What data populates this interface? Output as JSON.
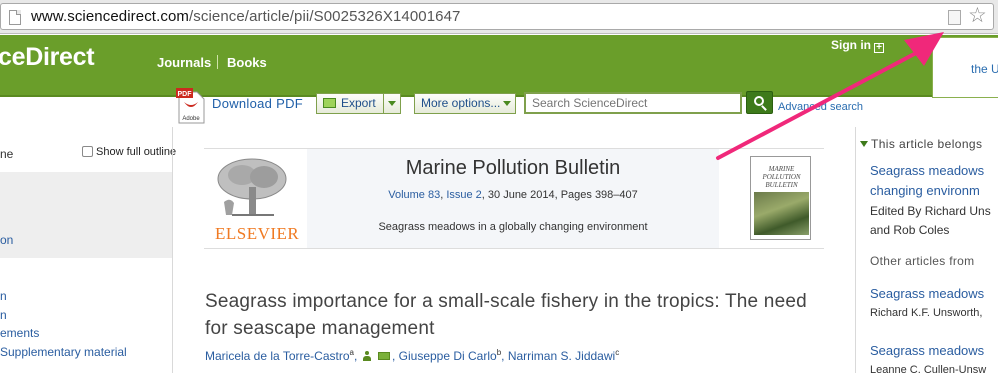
{
  "browser": {
    "url_host": "www.sciencedirect.com",
    "url_path": "/science/article/pii/S0025326X14001647"
  },
  "header": {
    "logo": "ceDirect",
    "nav": [
      "Journals",
      "Books"
    ],
    "sign_in": "Sign in",
    "institution_text": "the U"
  },
  "toolbar": {
    "download_pdf": "Download PDF",
    "pdf_icon_text": "PDF",
    "pdf_icon_sub": "Adobe",
    "export": "Export",
    "more_options": "More options...",
    "search_placeholder": "Search ScienceDirect",
    "advanced_search": "Advanced search"
  },
  "outline": {
    "label": "ne",
    "show_full_outline": "Show full outline",
    "items": [
      "on",
      "n",
      "n",
      "ements",
      "Supplementary material"
    ]
  },
  "journal": {
    "publisher": "ELSEVIER",
    "title": "Marine Pollution Bulletin",
    "volume": "Volume 83",
    "issue": "Issue 2",
    "date_pages": ", 30 June 2014, Pages 398–407",
    "special_issue": "Seagrass meadows in a globally changing environment",
    "cover_title": "MARINE POLLUTION BULLETIN"
  },
  "article": {
    "title": "Seagrass importance for a small-scale fishery in the tropics: The need for seascape management",
    "authors": [
      {
        "name": "Maricela de la Torre-Castro",
        "sup": "a"
      },
      {
        "name": "Giuseppe Di Carlo",
        "sup": "b"
      },
      {
        "name": "Narriman S. Jiddawi",
        "sup": "c"
      }
    ]
  },
  "right_sidebar": {
    "heading": "This article belongs",
    "issue_link_1": "Seagrass meadows",
    "issue_link_2": "changing environm",
    "edited_by": "Edited By Richard Uns",
    "edited_by_2": "and Rob Coles",
    "other_articles": "Other articles from",
    "related": [
      {
        "title": "Seagrass meadows",
        "author": "Richard K.F. Unsworth,"
      },
      {
        "title": "Seagrass meadows",
        "author": "Leanne C. Cullen-Unsw"
      }
    ]
  },
  "colors": {
    "header_green": "#6a9e2a",
    "link_blue": "#2a5da0",
    "arrow_pink": "#f0287a"
  }
}
